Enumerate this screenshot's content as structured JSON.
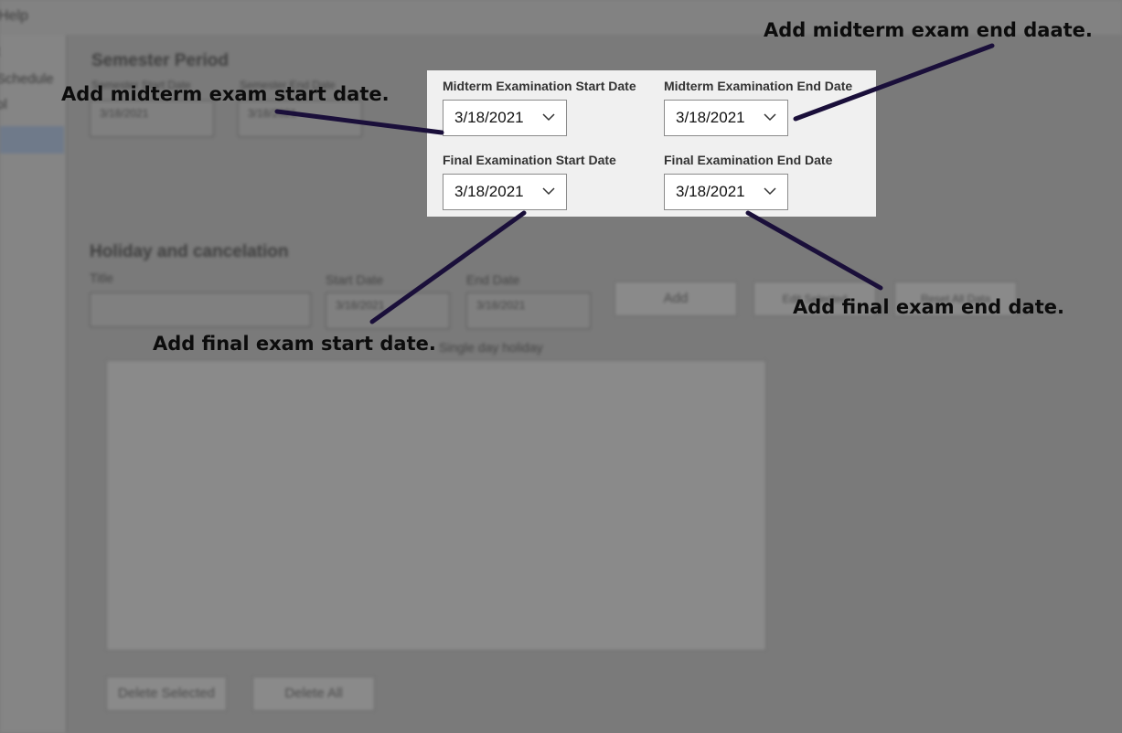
{
  "background_app": {
    "menu_help": "Help",
    "sidebar_items": [
      "t",
      "Schedule",
      "ol"
    ],
    "semester_period_heading": "Semester Period",
    "semester_start_label": "Semester Start Date",
    "semester_end_label": "Semester End Date",
    "semester_start_value": "3/18/2021",
    "semester_end_value": "3/18/2021",
    "holiday_heading": "Holiday and cancelation",
    "title_label": "Title",
    "start_date_label": "Start Date",
    "end_date_label": "End Date",
    "start_date_value": "3/18/2021",
    "end_date_value": "3/18/2021",
    "add_button": "Add",
    "edit_button": "Edit Selected",
    "reset_button": "Reset All Data",
    "single_day_note": "Single day holiday",
    "delete_selected_button": "Delete Selected",
    "delete_all_button": "Delete All"
  },
  "panel": {
    "midterm_start_label": "Midterm Examination  Start Date",
    "midterm_end_label": "Midterm Examination End Date",
    "final_start_label": "Final Examination  Start Date",
    "final_end_label": "Final Examination End Date",
    "midterm_start_value": "3/18/2021",
    "midterm_end_value": "3/18/2021",
    "final_start_value": "3/18/2021",
    "final_end_value": "3/18/2021"
  },
  "annotations": {
    "midterm_start": "Add midterm exam start date.",
    "midterm_end": "Add midterm exam end daate.",
    "final_start": "Add final exam start date.",
    "final_end": "Add final exam end date."
  },
  "colors": {
    "overlay": "#7a7a7a",
    "panel_bg": "#f0f0f0",
    "arrow": "#1a0f3a"
  },
  "icons": {
    "dropdown": "chevron-down-icon"
  }
}
